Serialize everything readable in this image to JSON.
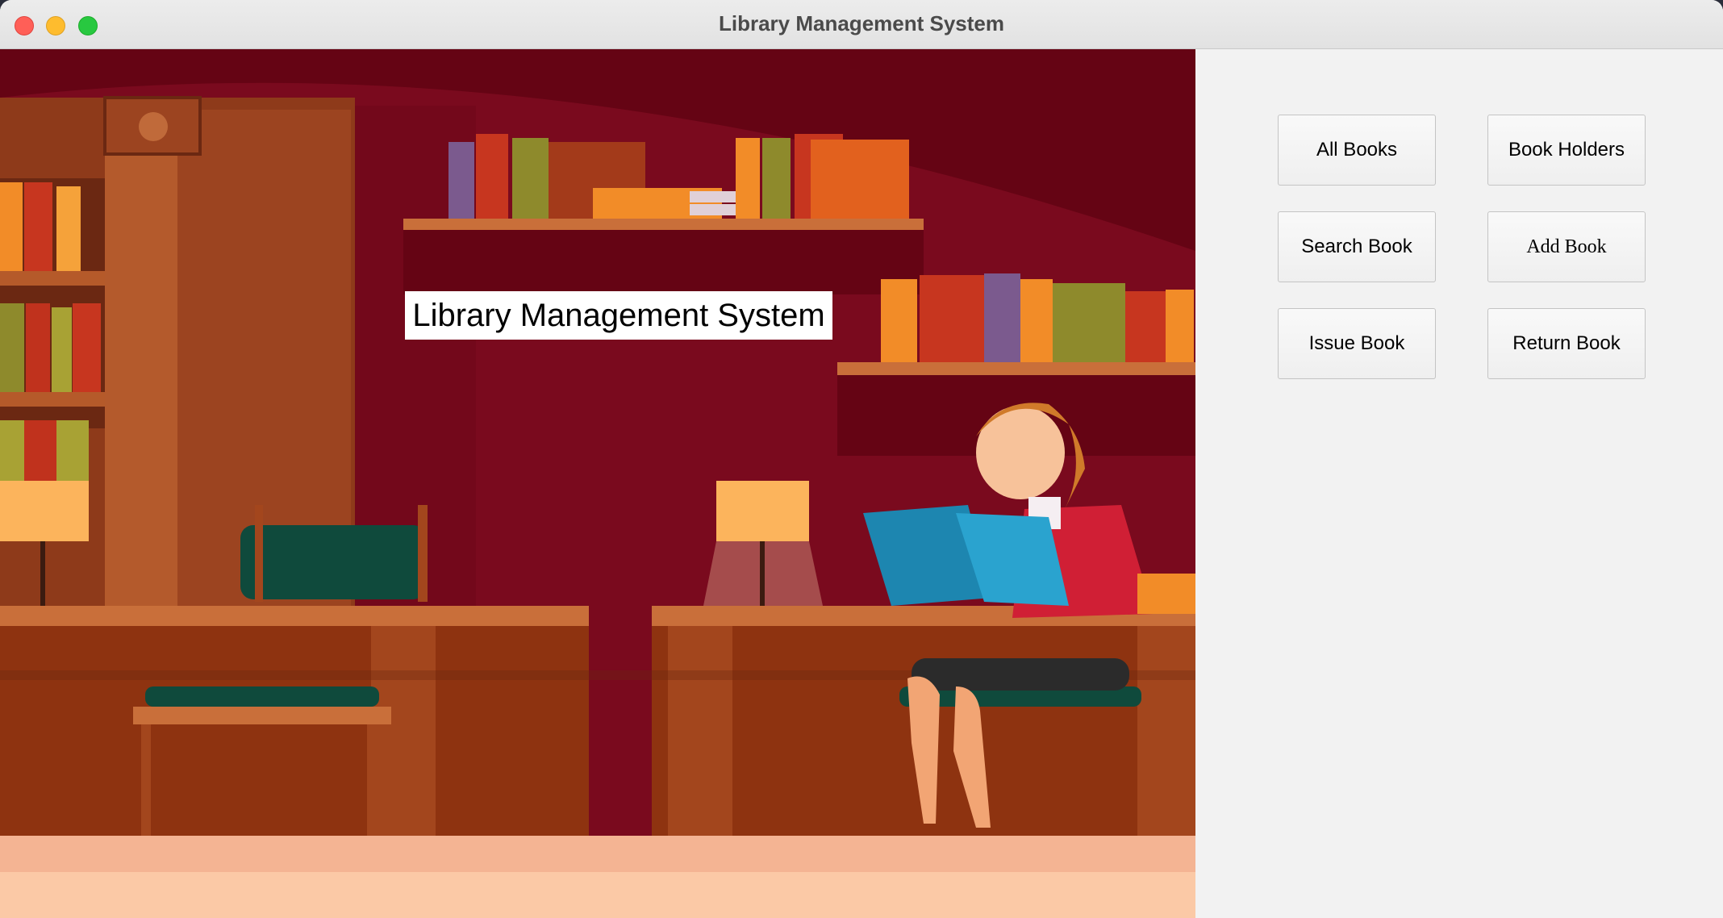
{
  "window": {
    "title": "Library Management System"
  },
  "banner": {
    "text": "Library Management System"
  },
  "buttons": {
    "all_books": "All Books",
    "book_holders": "Book Holders",
    "search_book": "Search Book",
    "add_book": "Add Book",
    "issue_book": "Issue Book",
    "return_book": "Return Book"
  },
  "colors": {
    "wall": "#7a0a1e",
    "wood": "#a3461d",
    "floor": "#f4b493",
    "panel_bg": "#f2f2f2"
  }
}
